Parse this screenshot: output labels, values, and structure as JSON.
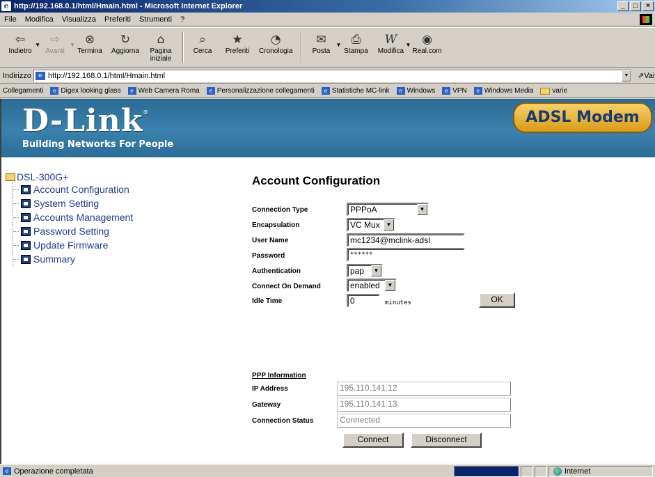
{
  "window": {
    "title": "http://192.168.0.1/html/Hmain.html - Microsoft Internet Explorer",
    "minimize": "_",
    "maximize": "□",
    "close": "×"
  },
  "menu": [
    "File",
    "Modifica",
    "Visualizza",
    "Preferiti",
    "Strumenti",
    "?"
  ],
  "toolbar": [
    {
      "label": "Indietro",
      "icon": "back-arrow-icon",
      "glyph": "⇦",
      "dropdown": true
    },
    {
      "label": "Avanti",
      "icon": "forward-arrow-icon",
      "glyph": "⇨",
      "disabled": true,
      "dropdown": true
    },
    {
      "label": "Termina",
      "icon": "stop-icon",
      "glyph": "⊗"
    },
    {
      "label": "Aggiorna",
      "icon": "refresh-icon",
      "glyph": "↻"
    },
    {
      "label": "Pagina\niniziale",
      "icon": "home-icon",
      "glyph": "⌂"
    },
    {
      "label": "Cerca",
      "icon": "search-icon",
      "glyph": "⌕"
    },
    {
      "label": "Preferiti",
      "icon": "favorites-icon",
      "glyph": "★"
    },
    {
      "label": "Cronologia",
      "icon": "history-icon",
      "glyph": "◔"
    },
    {
      "label": "Posta",
      "icon": "mail-icon",
      "glyph": "✉",
      "dropdown": true
    },
    {
      "label": "Stampa",
      "icon": "print-icon",
      "glyph": "⎙"
    },
    {
      "label": "Modifica",
      "icon": "edit-icon",
      "glyph": "W",
      "dropdown": true
    },
    {
      "label": "Real.com",
      "icon": "real-com-icon",
      "glyph": "◉"
    }
  ],
  "address": {
    "label": "Indirizzo",
    "url": "http://192.168.0.1/html/Hmain.html",
    "go": "Vai"
  },
  "links": {
    "label": "Collegamenti",
    "items": [
      "Digex looking glass",
      "Web Camera Roma",
      "Personalizzazione collegamenti",
      "Statistiche MC-link",
      "Windows",
      "VPN",
      "Windows Media"
    ],
    "folder": "varie"
  },
  "banner": {
    "logo": "D-Link",
    "reg": "®",
    "tagline": "Building Networks For People",
    "product": "ADSL Modem",
    "colors": {
      "banner": "#2c6b94",
      "badge": "#e8b440"
    }
  },
  "nav": {
    "root": "DSL-300G+",
    "items": [
      "Account Configuration",
      "System Setting",
      "Accounts Management",
      "Password Setting",
      "Update Firmware",
      "Summary"
    ]
  },
  "form": {
    "title": "Account Configuration",
    "connection_type": {
      "label": "Connection Type",
      "value": "PPPoA"
    },
    "encapsulation": {
      "label": "Encapsulation",
      "value": "VC Mux"
    },
    "user_name": {
      "label": "User Name",
      "value": "mc1234@mclink-adsl"
    },
    "password": {
      "label": "Password",
      "value": "******"
    },
    "authentication": {
      "label": "Authentication",
      "value": "pap"
    },
    "connect_on_demand": {
      "label": "Connect On Demand",
      "value": "enabled"
    },
    "idle_time": {
      "label": "Idle Time",
      "value": "0",
      "unit": "minutes"
    },
    "ok": "OK"
  },
  "ppp": {
    "heading": "PPP Information",
    "ip_address": {
      "label": "IP Address",
      "value": "195.110.141.12"
    },
    "gateway": {
      "label": "Gateway",
      "value": "195.110.141.13"
    },
    "status": {
      "label": "Connection Status",
      "value": "Connected"
    },
    "connect": "Connect",
    "disconnect": "Disconnect"
  },
  "status": {
    "message": "Operazione completata",
    "zone": "Internet"
  }
}
